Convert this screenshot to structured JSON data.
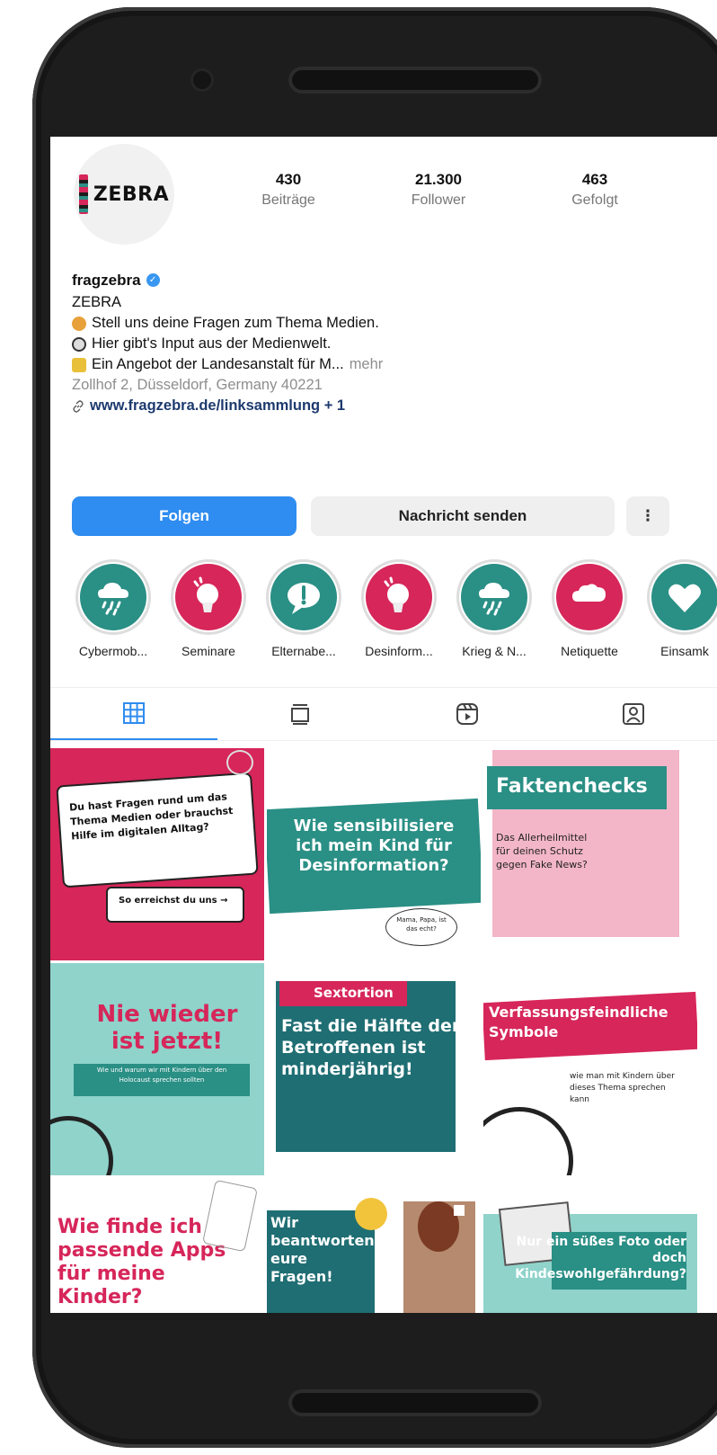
{
  "profile": {
    "logo_text": "ZEBRA",
    "stats": [
      {
        "value": "430",
        "label": "Beiträge"
      },
      {
        "value": "21.300",
        "label": "Follower"
      },
      {
        "value": "463",
        "label": "Gefolgt"
      }
    ],
    "username": "fragzebra",
    "display_name": "ZEBRA",
    "bio_lines": [
      "Stell uns deine Fragen zum Thema Medien.",
      "Hier gibt's Input aus der Medienwelt.",
      "Ein Angebot der Landesanstalt für M..."
    ],
    "more_label": "mehr",
    "location": "Zollhof 2, Düsseldorf, Germany 40221",
    "link": "www.fragzebra.de/linksammlung + 1"
  },
  "buttons": {
    "follow": "Folgen",
    "message": "Nachricht senden",
    "more": "⋮"
  },
  "highlights": [
    {
      "label": "Cybermob...",
      "color": "#2a8f85",
      "icon": "cloud-rain-icon"
    },
    {
      "label": "Seminare",
      "color": "#d6265a",
      "icon": "lightbulb-icon"
    },
    {
      "label": "Elternabe...",
      "color": "#2a8f85",
      "icon": "speech-exclamation-icon"
    },
    {
      "label": "Desinform...",
      "color": "#d6265a",
      "icon": "lightbulb-icon"
    },
    {
      "label": "Krieg & N...",
      "color": "#2a8f85",
      "icon": "cloud-rain-icon"
    },
    {
      "label": "Netiquette",
      "color": "#d6265a",
      "icon": "speech-cloud-icon"
    },
    {
      "label": "Einsamk",
      "color": "#2a8f85",
      "icon": "heart-icon"
    }
  ],
  "tabs": [
    "grid-icon",
    "reels-feed-icon",
    "reels-icon",
    "tagged-icon"
  ],
  "posts": [
    {
      "title": "Du hast Fragen rund um das Thema Medien oder brauchst Hilfe im digitalen Alltag?",
      "sub": "So erreichst du uns →"
    },
    {
      "title": "Wie sensibilisiere ich mein Kind für Desinformation?",
      "sub": "Mama, Papa, ist das echt?"
    },
    {
      "title": "Faktenchecks",
      "sub": "Das Allerheilmittel für deinen Schutz gegen Fake News?"
    },
    {
      "title": "Nie wieder ist jetzt!",
      "sub": "Wie und warum wir mit Kindern über den Holocaust sprechen sollten"
    },
    {
      "title": "Fast die Hälfte der Betroffenen ist minderjährig!",
      "sub": "Sextortion"
    },
    {
      "title": "Verfassungsfeindliche Symbole",
      "sub": "wie man mit Kindern über dieses Thema sprechen kann"
    },
    {
      "title": "Wie finde ich passende Apps für meine Kinder?",
      "sub": ""
    },
    {
      "title": "Wir beantworten eure Fragen!",
      "sub": ""
    },
    {
      "title": "Nur ein süßes Foto oder doch Kindeswohlgefährdung?",
      "sub": ""
    }
  ],
  "colors": {
    "pink": "#d6265a",
    "teal": "#2a8f85",
    "light_teal": "#8fd3cb",
    "light_pink": "#f3b6c8",
    "blue": "#2f8cf0"
  }
}
